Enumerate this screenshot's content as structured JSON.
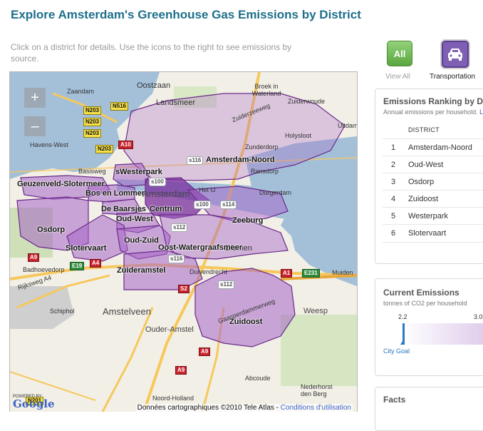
{
  "header": {
    "title": "Explore Amsterdam's Greenhouse Gas Emissions by District",
    "subtitle": "Click on a district for details. Use the icons to the right to see emissions by source."
  },
  "map": {
    "zoom_in": "+",
    "zoom_out": "–",
    "districts": [
      {
        "name": "Amsterdam-Noord"
      },
      {
        "name": "sWesterpark"
      },
      {
        "name": "Geuzenveld-Slotermeer"
      },
      {
        "name": "Bos en Lommer"
      },
      {
        "name": "De Baarsjes"
      },
      {
        "name": "Centrum"
      },
      {
        "name": "Oud-West"
      },
      {
        "name": "Zeeburg"
      },
      {
        "name": "Osdorp"
      },
      {
        "name": "Slotervaart"
      },
      {
        "name": "Oud-Zuid"
      },
      {
        "name": "Oost-Watergraafsmeer"
      },
      {
        "name": "Zuideramstel"
      },
      {
        "name": "Zuidoost"
      }
    ],
    "places": {
      "oostzaan": "Oostzaan",
      "zaandam": "Zaandam",
      "landsmeer": "Landsmeer",
      "broek": "Broek in Waterland",
      "zuiderwoude": "Zuiderwoude",
      "havens_west": "Havens-West",
      "zunderdorp": "Zunderdorp",
      "holysloot": "Holysloot",
      "ransdorp": "Ransdorp",
      "durgerdam": "Durgerdam",
      "amsterdam": "Amsterdam",
      "diemen": "Diemen",
      "duivendrecht": "Duivendrecht",
      "badhoevedorp": "Badhoevedorp",
      "schiphol": "Schiphol",
      "amstelveen": "Amstelveen",
      "ouder_amstel": "Ouder-Amstel",
      "weesp": "Weesp",
      "muiden": "Muiden",
      "abcoude": "Abcoude",
      "noord_holland": "Noord-Holland",
      "nederhorst": "Nederhorst den Berg",
      "basisweg": "Basisweg",
      "het_ij": "Het IJ",
      "rijksweg": "Rijksweg A4",
      "zuiderzeeweg": "Zuiderzeeweg",
      "zaandammerweg": "Gaasperdammerweg",
      "uitdam": "Uitdam",
      "zuidoostbeemster": "Zuidoost"
    },
    "shields": {
      "n203a": "N203",
      "n203b": "N203",
      "n203c": "N203",
      "n203d": "N203",
      "n516": "N516",
      "a10": "A10",
      "a9a": "A9",
      "a9b": "A9",
      "a9c": "A9",
      "a1": "A1",
      "e231": "E231",
      "e19": "E19",
      "a4": "A4",
      "n201": "N201",
      "s100a": "s100",
      "s100b": "s100",
      "s114": "s114",
      "s112a": "s112",
      "s112b": "s112",
      "s116a": "s116",
      "s116b": "s116",
      "s2": "S2"
    },
    "footer_text": "Données cartographiques ©2010 Tele Atlas - ",
    "footer_link": "Conditions d'utilisation",
    "powered_by": "POWERED BY",
    "google": "Google"
  },
  "source_icons": {
    "all_label": "All",
    "all_caption": "View All",
    "transport_caption": "Transportation"
  },
  "ranking": {
    "title": "Emissions Ranking by Dis",
    "subtitle": "Annual emissions per household. ",
    "subtitle_link": "L",
    "column_header": "DISTRICT",
    "rows": [
      {
        "rank": "1",
        "district": "Amsterdam-Noord"
      },
      {
        "rank": "2",
        "district": "Oud-West"
      },
      {
        "rank": "3",
        "district": "Osdorp"
      },
      {
        "rank": "4",
        "district": "Zuidoost"
      },
      {
        "rank": "5",
        "district": "Westerpark"
      },
      {
        "rank": "6",
        "district": "Slotervaart"
      }
    ]
  },
  "current": {
    "title": "Current Emissions",
    "subtitle": "tonnes of CO2 per household",
    "tick_low": "2.2",
    "tick_high": "3.0",
    "goal_label": "City Goal"
  },
  "facts": {
    "title": "Facts"
  },
  "colors": {
    "title": "#1d6f8c",
    "district_fill": "#a564c7",
    "district_dark": "#7a2e9e",
    "water": "#a4c0d9",
    "all_green": "#5aa640",
    "transport_purple": "#7f5fb3"
  }
}
